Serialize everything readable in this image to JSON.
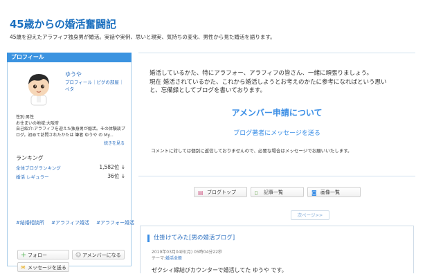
{
  "header": {
    "title": "45歳からの婚活奮闘記",
    "description": "45歳を迎えたアラフィフ独身男が婚活。実話や実例、思いと現実、気持ちの変化、男性から見た婚活を語ります。"
  },
  "sidebar": {
    "heading": "プロフィール",
    "user_name": "ゆうや",
    "profile_links": "プロフィール｜ピグの部屋｜ペタ",
    "info": {
      "gender": "性別:男性",
      "location": "お住まいの地域:大阪府",
      "intro": "自己紹介:アラフィフを迎えた独身男が婚活。その体験談ブログ。初めて訪問されたかたは 筆者 ゆうや の My..."
    },
    "more_link": "続きを見る",
    "ranking": {
      "title": "ランキング",
      "rows": [
        {
          "label": "全体ブログランキング",
          "value": "1,582位 ↓"
        },
        {
          "label": "婚活 レギュラー",
          "value": "36位 ↓"
        }
      ]
    },
    "tags": [
      "#結婚相談所",
      "#アラフィフ婚活",
      "#アラフォー婚活"
    ],
    "buttons": {
      "follow": "フォロー",
      "amember": "アメンバーになる",
      "message": "メッセージを送る"
    }
  },
  "main": {
    "intro_lines": [
      "婚活しているかた、特にアラフォー、アラフィフの皆さん、一緒に頑張りましょう。",
      "現在 婚活されているかた、これから婚活しようとお考えのかたに参考になればという思い",
      "と、忘備録としてブログを書いております。"
    ],
    "amember_heading": "アメンバー申請について",
    "message_link": "ブログ著者にメッセージを送る",
    "note": "コメントに対しては個別に返信しておりませんので、必要な場合はメッセージでお願いいたします。",
    "nav": {
      "top": "ブログトップ",
      "entries": "記事一覧",
      "images": "画像一覧"
    },
    "next_page": "次ページ>>"
  },
  "entry": {
    "title": "仕掛けてみた[男の婚活ブログ]",
    "date": "2019年03月04日(月) 05時04分22秒",
    "theme_label": "テーマ:",
    "theme_link": "婚活全般",
    "body": "ゼクシィ縁結びカウンターで婚活してた ゆうや です。"
  },
  "colors": {
    "accent": "#3b93e0",
    "link": "#2b6fc0",
    "border": "#a8cde9"
  }
}
